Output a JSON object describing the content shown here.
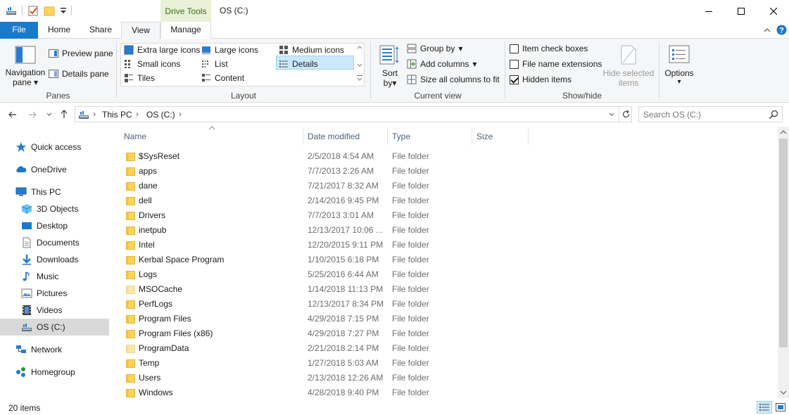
{
  "window": {
    "drive_tools": "Drive Tools",
    "title": "OS (C:)"
  },
  "tabs": {
    "file": "File",
    "home": "Home",
    "share": "Share",
    "view": "View",
    "manage": "Manage"
  },
  "ribbon": {
    "panes": {
      "label": "Panes",
      "navigation_pane_line1": "Navigation",
      "navigation_pane_line2": "pane",
      "preview_pane": "Preview pane",
      "details_pane": "Details pane"
    },
    "layout": {
      "label": "Layout",
      "extra_large_icons": "Extra large icons",
      "large_icons": "Large icons",
      "medium_icons": "Medium icons",
      "small_icons": "Small icons",
      "list": "List",
      "details": "Details",
      "tiles": "Tiles",
      "content": "Content"
    },
    "current_view": {
      "label": "Current view",
      "sort_line1": "Sort",
      "sort_line2": "by",
      "group_by": "Group by",
      "add_columns": "Add columns",
      "size_all_columns": "Size all columns to fit"
    },
    "show_hide": {
      "label": "Show/hide",
      "item_check_boxes": "Item check boxes",
      "file_name_extensions": "File name extensions",
      "hidden_items": "Hidden items",
      "hide_selected_line1": "Hide selected",
      "hide_selected_line2": "items",
      "options": "Options"
    }
  },
  "address": {
    "crumbs": [
      "This PC",
      "OS (C:)"
    ]
  },
  "search": {
    "placeholder": "Search OS (C:)"
  },
  "nav": {
    "quick_access": "Quick access",
    "onedrive": "OneDrive",
    "this_pc": "This PC",
    "objects_3d": "3D Objects",
    "desktop": "Desktop",
    "documents": "Documents",
    "downloads": "Downloads",
    "music": "Music",
    "pictures": "Pictures",
    "videos": "Videos",
    "os_c": "OS (C:)",
    "network": "Network",
    "homegroup": "Homegroup"
  },
  "columns": {
    "name": "Name",
    "date_modified": "Date modified",
    "type": "Type",
    "size": "Size"
  },
  "files": [
    {
      "name": "$SysReset",
      "date": "2/5/2018 4:54 AM",
      "type": "File folder"
    },
    {
      "name": "apps",
      "date": "7/7/2013 2:26 AM",
      "type": "File folder"
    },
    {
      "name": "dane",
      "date": "7/21/2017 8:32 AM",
      "type": "File folder"
    },
    {
      "name": "dell",
      "date": "2/14/2016 9:45 PM",
      "type": "File folder"
    },
    {
      "name": "Drivers",
      "date": "7/7/2013 3:01 AM",
      "type": "File folder"
    },
    {
      "name": "inetpub",
      "date": "12/13/2017 10:06 ...",
      "type": "File folder"
    },
    {
      "name": "Intel",
      "date": "12/20/2015 9:11 PM",
      "type": "File folder"
    },
    {
      "name": "Kerbal Space Program",
      "date": "1/10/2015 6:18 PM",
      "type": "File folder"
    },
    {
      "name": "Logs",
      "date": "5/25/2016 6:44 AM",
      "type": "File folder"
    },
    {
      "name": "MSOCache",
      "date": "1/14/2018 11:13 PM",
      "type": "File folder"
    },
    {
      "name": "PerfLogs",
      "date": "12/13/2017 8:34 PM",
      "type": "File folder"
    },
    {
      "name": "Program Files",
      "date": "4/29/2018 7:15 PM",
      "type": "File folder"
    },
    {
      "name": "Program Files (x86)",
      "date": "4/29/2018 7:27 PM",
      "type": "File folder"
    },
    {
      "name": "ProgramData",
      "date": "2/21/2018 2:14 PM",
      "type": "File folder"
    },
    {
      "name": "Temp",
      "date": "1/27/2018 5:03 AM",
      "type": "File folder"
    },
    {
      "name": "Users",
      "date": "2/13/2018 12:26 AM",
      "type": "File folder"
    },
    {
      "name": "Windows",
      "date": "4/28/2018 9:40 PM",
      "type": "File folder"
    }
  ],
  "status": {
    "item_count": "20 items"
  },
  "colors": {
    "file_tab": "#1979ca",
    "selection": "#cce8ff",
    "folder": "#ffd35c",
    "drive_tools_bg": "#e9f2d6"
  }
}
